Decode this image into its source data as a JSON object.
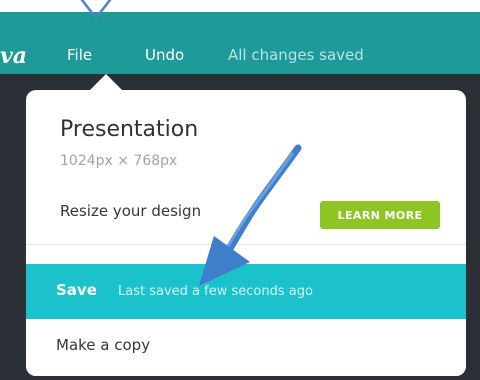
{
  "colors": {
    "topbar": "#1e9a9a",
    "dark_background": "#2b2f36",
    "learn_more": "#8cc524",
    "save_highlight": "#1bc1cb",
    "annotation": "#3f7fc9"
  },
  "header": {
    "logo_fragment": "va",
    "menu": {
      "file": "File",
      "undo": "Undo",
      "status": "All changes saved"
    }
  },
  "dropdown": {
    "title": "Presentation",
    "dimensions": "1024px × 768px",
    "resize_label": "Resize your design",
    "learn_more_label": "LEARN MORE",
    "save": {
      "label": "Save",
      "status": "Last saved a few seconds ago"
    },
    "copy_label": "Make a copy"
  },
  "annotations": {
    "icons": [
      "pointer-arrow-icon",
      "arrow-icon"
    ]
  }
}
